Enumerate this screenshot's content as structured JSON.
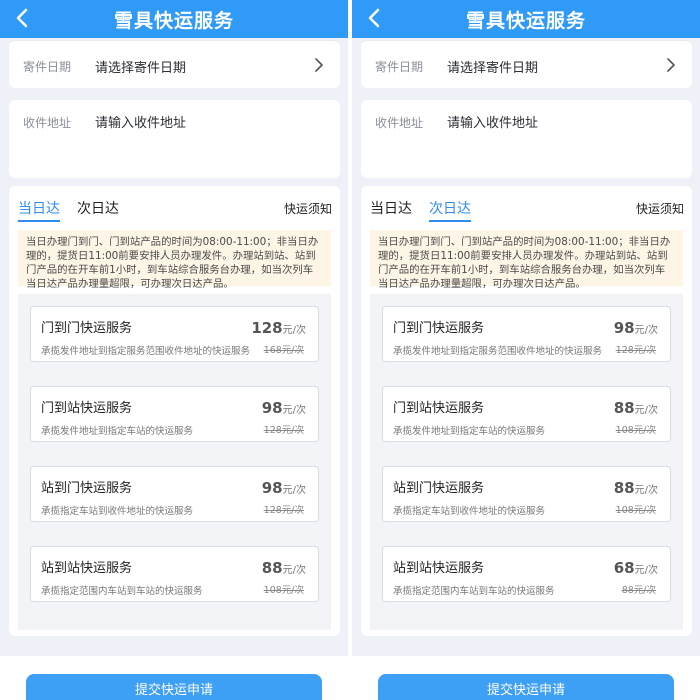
{
  "panels": [
    {
      "header_title": "雪具快运服务",
      "date_label": "寄件日期",
      "date_placeholder": "请选择寄件日期",
      "address_label": "收件地址",
      "address_placeholder": "请输入收件地址",
      "tabs": [
        "当日达",
        "次日达"
      ],
      "active_tab": 0,
      "notice_link": "快运须知",
      "notice_text": "当日办理门到门、门到站产品的时间为08:00-11:00；非当日办理的，提货日11:00前要安排人员办理发件。办理站到站、站到门产品的在开车前1小时，到车站综合服务台办理，如当次列车当日达产品办理量超限，可办理次日达产品。",
      "services": [
        {
          "name": "门到门快运服务",
          "desc": "承揽发件地址到指定服务范围收件地址的快运服务",
          "price": "128",
          "unit": "元/次",
          "old_price": "168元/次"
        },
        {
          "name": "门到站快运服务",
          "desc": "承揽发件地址到指定车站的快运服务",
          "price": "98",
          "unit": "元/次",
          "old_price": "128元/次"
        },
        {
          "name": "站到门快运服务",
          "desc": "承揽指定车站到收件地址的快运服务",
          "price": "98",
          "unit": "元/次",
          "old_price": "128元/次"
        },
        {
          "name": "站到站快运服务",
          "desc": "承揽指定范围内车站到车站的快运服务",
          "price": "88",
          "unit": "元/次",
          "old_price": "108元/次"
        }
      ],
      "submit_label": "提交快运申请"
    },
    {
      "header_title": "雪具快运服务",
      "date_label": "寄件日期",
      "date_placeholder": "请选择寄件日期",
      "address_label": "收件地址",
      "address_placeholder": "请输入收件地址",
      "tabs": [
        "当日达",
        "次日达"
      ],
      "active_tab": 1,
      "notice_link": "快运须知",
      "notice_text": "当日办理门到门、门到站产品的时间为08:00-11:00；非当日办理的，提货日11:00前要安排人员办理发件。办理站到站、站到门产品的在开车前1小时，到车站综合服务台办理，如当次列车当日达产品办理量超限，可办理次日达产品。",
      "services": [
        {
          "name": "门到门快运服务",
          "desc": "承揽发件地址到指定服务范围收件地址的快运服务",
          "price": "98",
          "unit": "元/次",
          "old_price": "128元/次"
        },
        {
          "name": "门到站快运服务",
          "desc": "承揽发件地址到指定车站的快运服务",
          "price": "88",
          "unit": "元/次",
          "old_price": "108元/次"
        },
        {
          "name": "站到门快运服务",
          "desc": "承揽指定车站到收件地址的快运服务",
          "price": "88",
          "unit": "元/次",
          "old_price": "108元/次"
        },
        {
          "name": "站到站快运服务",
          "desc": "承揽指定范围内车站到车站的快运服务",
          "price": "68",
          "unit": "元/次",
          "old_price": "88元/次"
        }
      ],
      "submit_label": "提交快运申请"
    }
  ],
  "colors": {
    "header": "#2f9af7",
    "accent": "#2f8cf0",
    "notice_bg": "#fdf6e7",
    "button": "#3ea0f5"
  },
  "icons": {
    "back": "chevron-left-icon",
    "date_arrow": "chevron-right-icon"
  }
}
